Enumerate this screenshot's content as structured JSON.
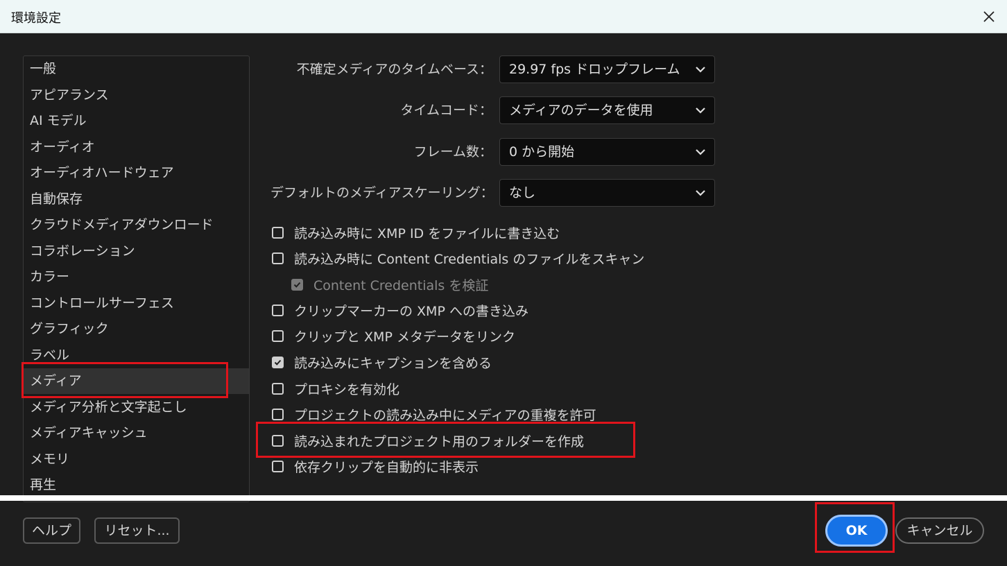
{
  "window": {
    "title": "環境設定"
  },
  "sidebar": {
    "items": [
      "一般",
      "アピアランス",
      "AI モデル",
      "オーディオ",
      "オーディオハードウェア",
      "自動保存",
      "クラウドメディアダウンロード",
      "コラボレーション",
      "カラー",
      "コントロールサーフェス",
      "グラフィック",
      "ラベル",
      "メディア",
      "メディア分析と文字起こし",
      "メディアキャッシュ",
      "メモリ",
      "再生"
    ],
    "selected": "メディア"
  },
  "settings": {
    "rows": [
      {
        "label": "不確定メディアのタイムベース：",
        "value": "29.97 fps ドロップフレーム"
      },
      {
        "label": "タイムコード：",
        "value": "メディアのデータを使用"
      },
      {
        "label": "フレーム数：",
        "value": "0 から開始"
      },
      {
        "label": "デフォルトのメディアスケーリング：",
        "value": "なし"
      }
    ],
    "checkboxes": [
      {
        "label": "読み込み時に XMP ID をファイルに書き込む",
        "checked": false,
        "disabled": false
      },
      {
        "label": "読み込み時に Content Credentials のファイルをスキャン",
        "checked": false,
        "disabled": false
      },
      {
        "label": "Content Credentials を検証",
        "checked": true,
        "disabled": true
      },
      {
        "label": "クリップマーカーの XMP への書き込み",
        "checked": false,
        "disabled": false
      },
      {
        "label": "クリップと XMP メタデータをリンク",
        "checked": false,
        "disabled": false
      },
      {
        "label": "読み込みにキャプションを含める",
        "checked": true,
        "disabled": false
      },
      {
        "label": "プロキシを有効化",
        "checked": false,
        "disabled": false
      },
      {
        "label": "プロジェクトの読み込み中にメディアの重複を許可",
        "checked": false,
        "disabled": false
      },
      {
        "label": "読み込まれたプロジェクト用のフォルダーを作成",
        "checked": false,
        "disabled": false
      },
      {
        "label": "依存クリップを自動的に非表示",
        "checked": false,
        "disabled": false
      }
    ]
  },
  "footer": {
    "help": "ヘルプ",
    "reset": "リセット...",
    "ok": "OK",
    "cancel": "キャンセル"
  },
  "colors": {
    "background": "#1e1e1e",
    "titlebar": "#eef7f7",
    "accent": "#1672e6",
    "highlight": "#e0141b"
  }
}
